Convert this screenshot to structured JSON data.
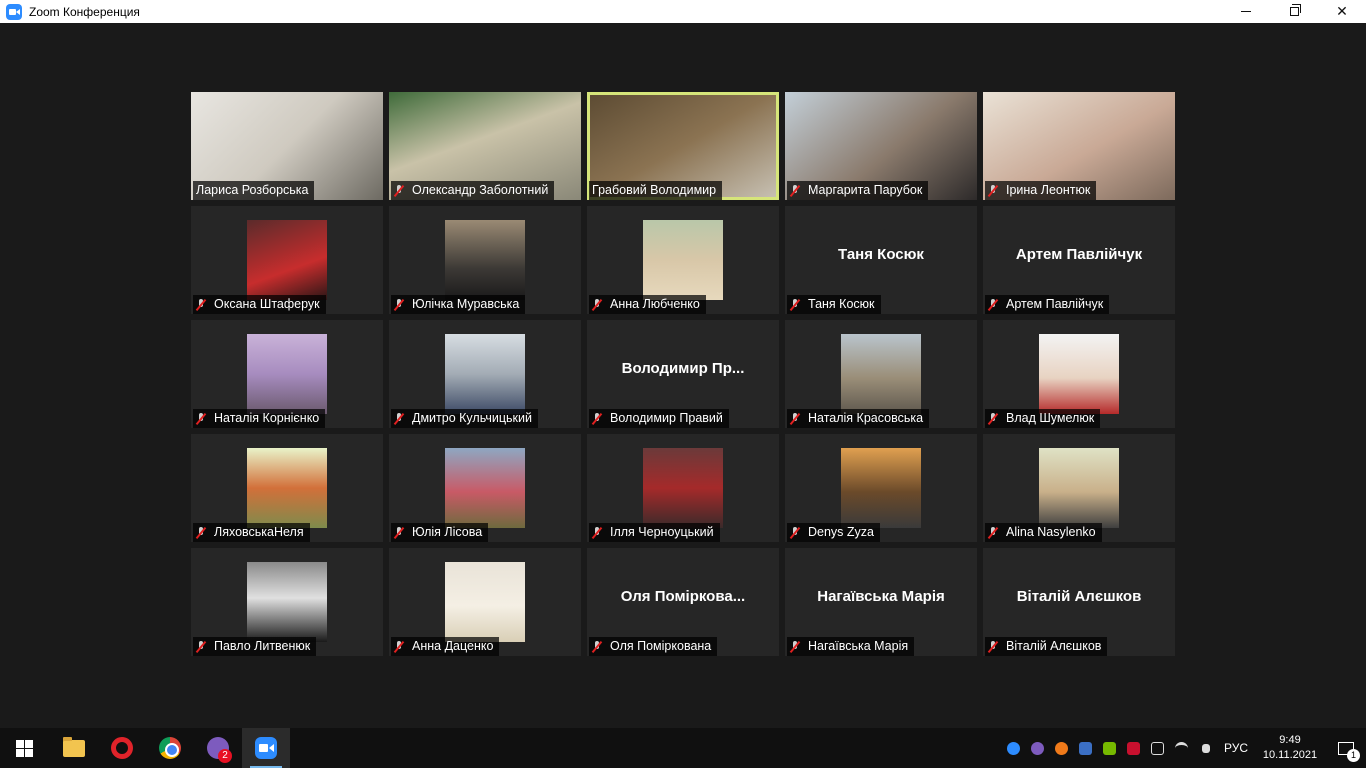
{
  "window": {
    "title": "Zoom Конференция",
    "minimize": "—",
    "close": "✕"
  },
  "participants": [
    {
      "name": "Лариса Розборська",
      "kind": "video",
      "muted": false
    },
    {
      "name": "Олександр Заболотний",
      "kind": "video",
      "muted": true
    },
    {
      "name": "Грабовий Володимир",
      "kind": "video",
      "muted": false,
      "active_speaker": true
    },
    {
      "name": "Маргарита Парубок",
      "kind": "video",
      "muted": true
    },
    {
      "name": "Ірина Леонтюк",
      "kind": "video",
      "muted": true
    },
    {
      "name": "Оксана Штаферук",
      "kind": "photo",
      "muted": true
    },
    {
      "name": "Юлічка Муравська",
      "kind": "photo",
      "muted": true
    },
    {
      "name": "Анна Любченко",
      "kind": "photo",
      "muted": true
    },
    {
      "name": "Таня Косюк",
      "kind": "name",
      "display": "Таня Косюк",
      "muted": true
    },
    {
      "name": "Артем Павлійчук",
      "kind": "name",
      "display": "Артем Павлійчук",
      "muted": true
    },
    {
      "name": "Наталія Корнієнко",
      "kind": "photo",
      "muted": true
    },
    {
      "name": "Дмитро Кульчицький",
      "kind": "photo",
      "muted": true
    },
    {
      "name": "Володимир Правий",
      "kind": "name",
      "display": "Володимир  Пр...",
      "muted": true
    },
    {
      "name": "Наталія Красовська",
      "kind": "photo",
      "muted": true
    },
    {
      "name": "Влад Шумелюк",
      "kind": "photo",
      "muted": true
    },
    {
      "name": "ЛяховськаНеля",
      "kind": "photo",
      "muted": true
    },
    {
      "name": "Юлія Лісова",
      "kind": "photo",
      "muted": true
    },
    {
      "name": "Ілля Черноуцький",
      "kind": "photo",
      "muted": true
    },
    {
      "name": "Denys Zyza",
      "kind": "photo",
      "muted": true
    },
    {
      "name": "Alina Nasylenko",
      "kind": "photo",
      "muted": true
    },
    {
      "name": "Павло Литвенюк",
      "kind": "photo",
      "muted": true
    },
    {
      "name": "Анна Даценко",
      "kind": "photo",
      "muted": true
    },
    {
      "name": "Оля Поміркована",
      "kind": "name",
      "display": "Оля  Поміркова...",
      "muted": true
    },
    {
      "name": "Нагаївська Марія",
      "kind": "name",
      "display": "Нагаївська Марія",
      "muted": true
    },
    {
      "name": "Віталій Алєшков",
      "kind": "name",
      "display": "Віталій Алєшков",
      "muted": true
    }
  ],
  "taskbar": {
    "viber_badge": "2",
    "language": "РУС",
    "time": "9:49",
    "date": "10.11.2021",
    "notifications": "1"
  },
  "colors": {
    "active_speaker_border": "#d6e57a",
    "zoom_blue": "#2d8cff",
    "muted_red": "#e02020"
  }
}
